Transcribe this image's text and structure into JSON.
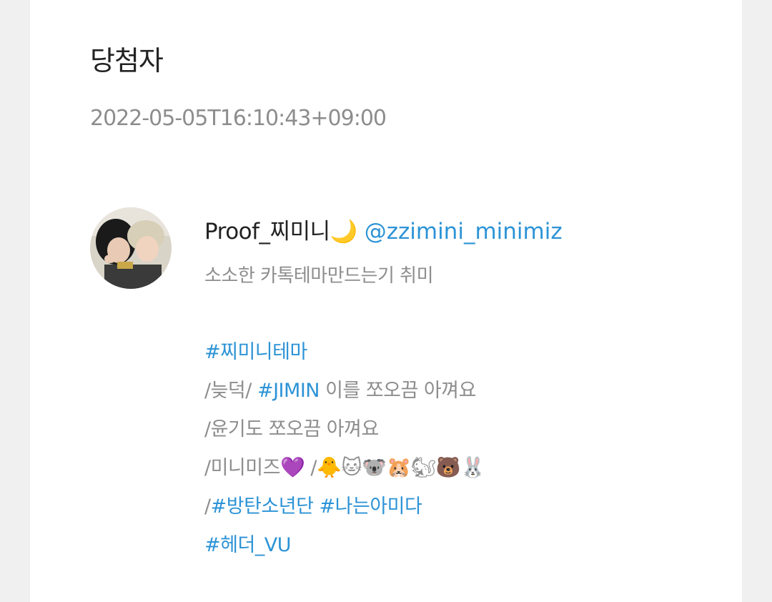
{
  "post": {
    "title": "당첨자",
    "timestamp": "2022-05-05T16:10:43+09:00"
  },
  "tweet": {
    "display_name": "Proof_찌미니🌙",
    "handle": "@zzimini_minimiz",
    "bio": "소소한 카톡테마만드는기 취미",
    "lines": {
      "l1_tag": "#찌미니테마",
      "l2_prefix": "/늦덕/ ",
      "l2_tag": "#JIMIN",
      "l2_suffix": " 이를 쪼오끔 아껴요",
      "l3": "/윤기도 쪼오끔 아껴요",
      "l4_prefix": "/미니미즈",
      "l4_heart": "💜",
      "l4_mid": " /",
      "l4_emojis": "🐥🐱🐨🐹🐿🐻🐰",
      "l5_prefix": "/",
      "l5_tag1": "#방탄소년단",
      "l5_space": " ",
      "l5_tag2": "#나는아미다",
      "l6_tag": "#헤더_VU"
    }
  },
  "colors": {
    "link": "#2c93d6",
    "muted": "#8d8d8d",
    "text": "#222222",
    "page_bg": "#f0f0f0",
    "card_bg": "#ffffff"
  },
  "icons": {
    "avatar": "profile-photo"
  }
}
